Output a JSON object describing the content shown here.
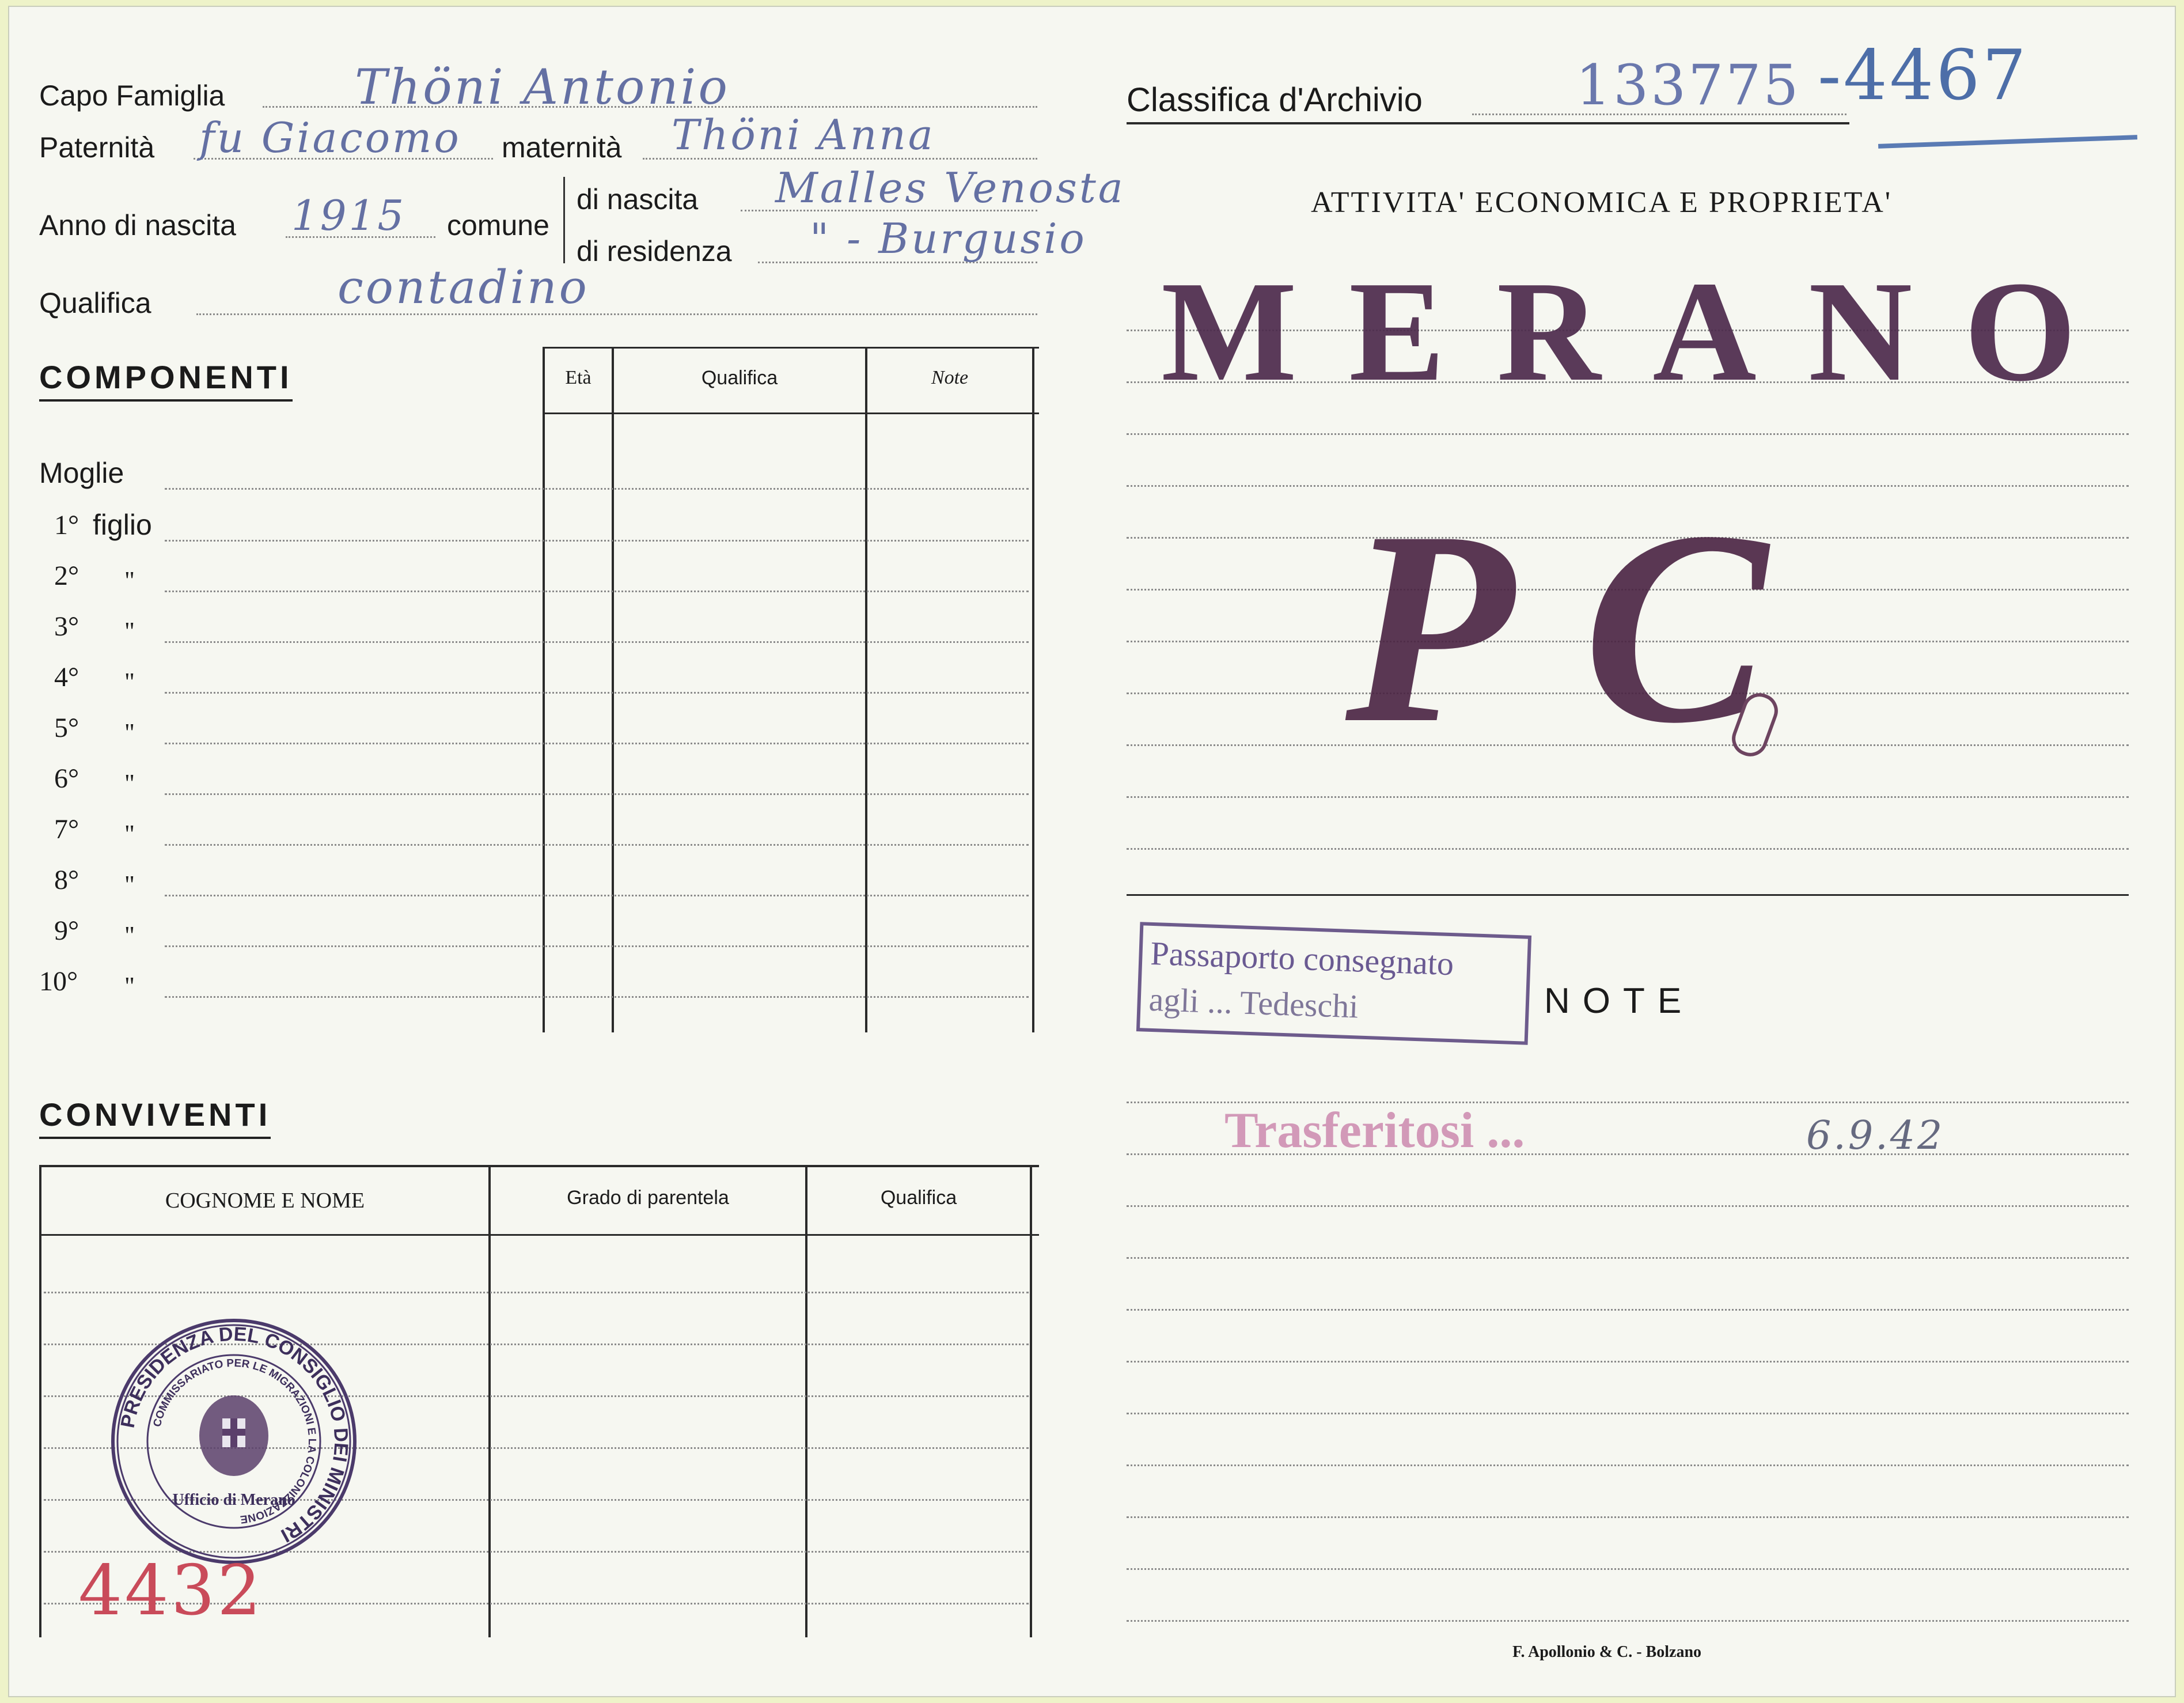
{
  "header": {
    "capo_famiglia_label": "Capo Famiglia",
    "capo_famiglia_value": "Thöni Antonio",
    "paternita_label": "Paternità",
    "paternita_value": "fu Giacomo",
    "maternita_label": "maternità",
    "maternita_value": "Thöni Anna",
    "anno_label": "Anno di nascita",
    "anno_value": "1915",
    "comune_label": "comune",
    "nascita_label": "di nascita",
    "nascita_value": "Malles Venosta",
    "residenza_label": "di residenza",
    "residenza_value": "\"     - Burgusio",
    "qualifica_label": "Qualifica",
    "qualifica_value": "contadino"
  },
  "archive": {
    "label": "Classifica d'Archivio",
    "value": "133775",
    "extra": "-4467"
  },
  "right_title": "ATTIVITA' ECONOMICA E PROPRIETA'",
  "stamps": {
    "merano": "MERANO",
    "pc": "PC",
    "passport_line1": "Passaporto consegnato",
    "passport_line2": "agli ... Tedeschi",
    "transfer": "Trasferitosi ...",
    "transfer_date": "6.9.42"
  },
  "componenti": {
    "heading": "COMPONENTI",
    "col_eta": "Età",
    "col_qualifica": "Qualifica",
    "col_note": "Note",
    "moglie": "Moglie",
    "figli": [
      {
        "num": "1°",
        "label": "figlio"
      },
      {
        "num": "2°",
        "label": "\""
      },
      {
        "num": "3°",
        "label": "\""
      },
      {
        "num": "4°",
        "label": "\""
      },
      {
        "num": "5°",
        "label": "\""
      },
      {
        "num": "6°",
        "label": "\""
      },
      {
        "num": "7°",
        "label": "\""
      },
      {
        "num": "8°",
        "label": "\""
      },
      {
        "num": "9°",
        "label": "\""
      },
      {
        "num": "10°",
        "label": "\""
      }
    ]
  },
  "notes_heading": "NOTE",
  "conviventi": {
    "heading": "CONVIVENTI",
    "col_nome": "COGNOME E NOME",
    "col_grado": "Grado di parentela",
    "col_qualifica": "Qualifica"
  },
  "seal": {
    "outer": "PRESIDENZA DEL CONSIGLIO DEI MINISTRI",
    "inner": "COMMISSARIATO PER LE MIGRAZIONI E LA COLONIZZAZIONE",
    "office": "Ufficio di Merano"
  },
  "handwritten_number": "4432",
  "printer": "F. Apollonio & C. - Bolzano",
  "colors": {
    "ink_handwriting": "#6470a3",
    "stamp_violet": "#4d2b4d",
    "stamp_pink": "#c77aa6",
    "pencil_red": "#c94b5a",
    "archive_blue": "#4d6ea8"
  }
}
